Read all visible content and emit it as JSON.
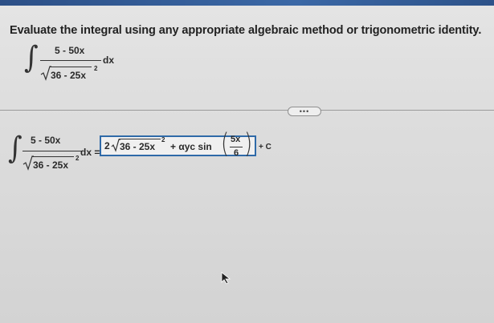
{
  "prompt": "Evaluate the integral using any appropriate algebraic method or trigonometric identity.",
  "integral": {
    "numerator": "5 - 50x",
    "radicand": "36 - 25x",
    "exponent": "2",
    "differential": "dx"
  },
  "answer": {
    "equals": "dx =",
    "coefficient": "2",
    "radicand": "36 - 25x",
    "exponent": "2",
    "middle": "+ αyc sin",
    "frac_num": "5x",
    "frac_den": "6",
    "constant": "+ C"
  },
  "more_button_label": "•••",
  "colors": {
    "top_bar": "#3b68a6",
    "answer_border": "#2f6aa8"
  }
}
